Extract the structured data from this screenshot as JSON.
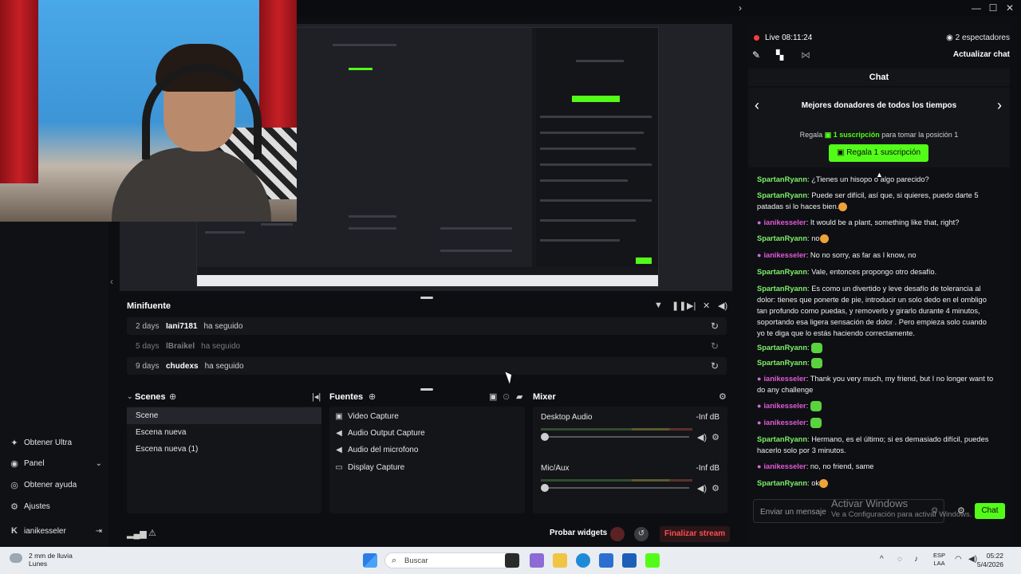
{
  "window": {
    "minimize": "—",
    "maximize": "☐",
    "close": "✕",
    "collapse": "›"
  },
  "sidebar": {
    "items": [
      {
        "label": "Obtener Ultra",
        "icon": "ultra-icon"
      },
      {
        "label": "Panel",
        "icon": "dashboard-icon"
      },
      {
        "label": "Obtener ayuda",
        "icon": "help-icon"
      },
      {
        "label": "Ajustes",
        "icon": "gear-icon"
      }
    ],
    "user": "ianikesseler"
  },
  "minifuente": {
    "title": "Minifuente",
    "rows": [
      {
        "when": "2 days",
        "who": "Iani7181",
        "action": "ha seguido"
      },
      {
        "when": "5 days",
        "who": "lBraikel",
        "action": "ha seguido"
      },
      {
        "when": "9 days",
        "who": "chudexs",
        "action": "ha seguido"
      }
    ]
  },
  "scenes": {
    "title": "Scenes",
    "items": [
      "Scene",
      "Escena nueva",
      "Escena nueva (1)"
    ],
    "selected": 0
  },
  "sources": {
    "title": "Fuentes",
    "items": [
      {
        "label": "Video Capture",
        "icon": "video-icon"
      },
      {
        "label": "Audio Output Capture",
        "icon": "speaker-icon"
      },
      {
        "label": "Audio del microfono",
        "icon": "speaker-icon"
      },
      {
        "label": "Display Capture",
        "icon": "monitor-icon"
      }
    ]
  },
  "mixer": {
    "title": "Mixer",
    "channels": [
      {
        "name": "Desktop Audio",
        "db": "-Inf dB"
      },
      {
        "name": "Mic/Aux",
        "db": "-Inf dB"
      }
    ]
  },
  "bottombar": {
    "test_widgets": "Probar widgets",
    "end_stream": "Finalizar stream"
  },
  "chat": {
    "live": "Live 08:11:24",
    "viewers": "2 espectadores",
    "update": "Actualizar chat",
    "header": "Chat",
    "donors_title": "Mejores donadores de todos los tiempos",
    "gift_prefix": "Regala",
    "gift_count": "1 suscripción",
    "gift_suffix": "para tomar la posición 1",
    "gift_button": "Regala 1 suscripción",
    "placeholder": "Enviar un mensaje",
    "send": "Chat",
    "messages": [
      {
        "user": "SpartanRyann",
        "text": "¿Tienes un hisopo o algo parecido?",
        "alt": false
      },
      {
        "user": "SpartanRyann",
        "text": "Puede ser difícil, así que, si quieres, puedo darte 5 patadas si lo haces bien.",
        "alt": false,
        "emoji": "y"
      },
      {
        "user": "ianikesseler",
        "text": "It would be a plant, something like that, right?",
        "alt": true
      },
      {
        "user": "SpartanRyann",
        "text": "no",
        "alt": false,
        "emoji": "y"
      },
      {
        "user": "ianikesseler",
        "text": "No no sorry, as far as I know, no",
        "alt": true
      },
      {
        "user": "SpartanRyann",
        "text": "Vale, entonces propongo otro desafío.",
        "alt": false
      },
      {
        "user": "SpartanRyann",
        "text": "Es como un divertido y leve desafío de tolerancia al dolor: tienes que ponerte de pie, introducir un solo dedo en el ombligo tan profundo como puedas, y removerlo y girarlo durante 4 minutos, soportando esa ligera sensación de dolor . Pero empieza solo cuando yo te diga que lo estás haciendo correctamente.",
        "alt": false
      },
      {
        "user": "SpartanRyann",
        "text": "",
        "alt": false,
        "emoji": "g"
      },
      {
        "user": "SpartanRyann",
        "text": "",
        "alt": false,
        "emoji": "g"
      },
      {
        "user": "ianikesseler",
        "text": "Thank you very much, my friend, but I no longer want to do any challenge",
        "alt": true
      },
      {
        "user": "ianikesseler",
        "text": "",
        "alt": true,
        "emoji": "g"
      },
      {
        "user": "ianikesseler",
        "text": "",
        "alt": true,
        "emoji": "g"
      },
      {
        "user": "SpartanRyann",
        "text": "Hermano, es el último; si es demasiado difícil, puedes hacerlo solo por 3 minutos.",
        "alt": false
      },
      {
        "user": "ianikesseler",
        "text": "no, no friend, same",
        "alt": true
      },
      {
        "user": "SpartanRyann",
        "text": "ok",
        "alt": false,
        "emoji": "y"
      }
    ]
  },
  "watermark": {
    "title": "Activar Windows",
    "sub": "Ve a Configuración para activar Windows."
  },
  "taskbar": {
    "weather": "2 mm de lluvia",
    "weather_sub": "Lunes",
    "search": "Buscar",
    "lang1": "ESP",
    "lang2": "LAA",
    "time": "05:22",
    "date": "5/4/2026"
  },
  "colors": {
    "accent": "#53fc18",
    "danger": "#ff4d4f",
    "live": "#ff3b3b"
  }
}
